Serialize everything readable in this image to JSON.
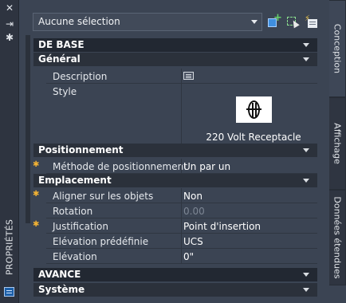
{
  "palette": {
    "title": "PROPRIÉTÉS"
  },
  "toolbar": {
    "selection_value": "Aucune sélection",
    "quick_select_icon": "quick-select-icon",
    "select_objects_icon": "select-objects-icon",
    "toggle_pickadd_icon": "toggle-pickadd-icon"
  },
  "sections": {
    "main_base": "DE BASE",
    "general": "Général",
    "positioning": "Positionnement",
    "location": "Emplacement",
    "main_advanced": "AVANCE",
    "system": "Système"
  },
  "properties": {
    "description": {
      "label": "Description",
      "icon": "description-edit-icon"
    },
    "style": {
      "label": "Style",
      "value": "220 Volt Receptacle"
    },
    "positioning_method": {
      "label": "Méthode de positionnement",
      "value": "Un par un"
    },
    "align_to_objects": {
      "label": "Aligner sur les objets",
      "value": "Non"
    },
    "rotation": {
      "label": "Rotation",
      "value": "0.00"
    },
    "justification": {
      "label": "Justification",
      "value": "Point d'insertion"
    },
    "preset_elevation": {
      "label": "Elévation prédéfinie",
      "value": "UCS"
    },
    "elevation": {
      "label": "Elévation",
      "value": "0\""
    }
  },
  "tabs": [
    "Conception",
    "Affichage",
    "Données étendues"
  ],
  "colors": {
    "panel": "#3b4453",
    "section_header": "#2b313b",
    "asterisk": "#f2b233"
  }
}
